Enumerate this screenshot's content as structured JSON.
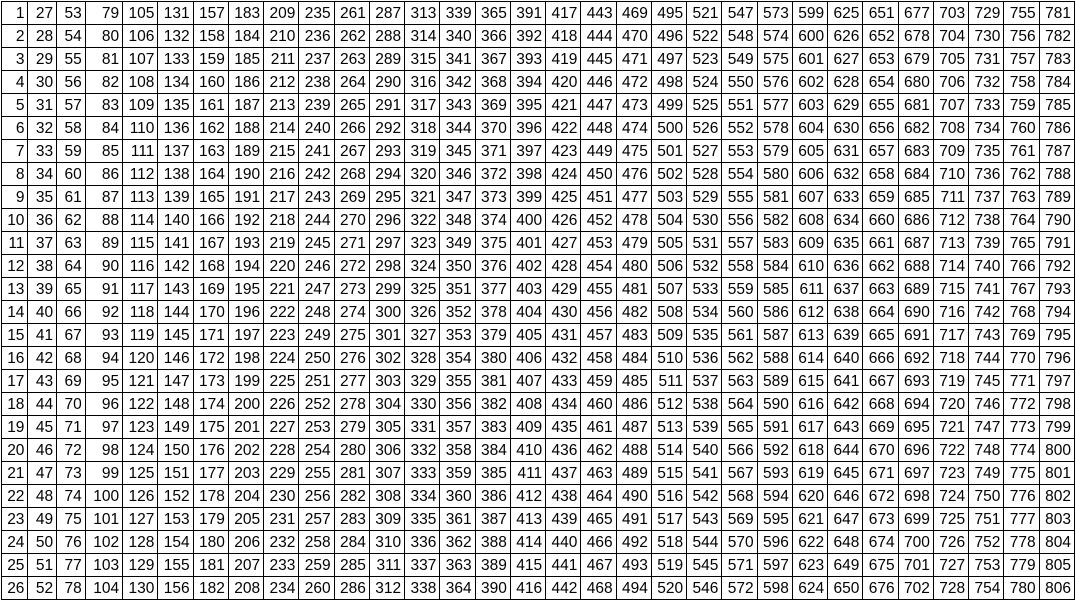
{
  "sheet": {
    "columns": 31,
    "rows": [
      [
        "1",
        "27",
        "53",
        "79",
        "105",
        "131",
        "157",
        "183",
        "209",
        "235",
        "261",
        "287",
        "313",
        "339",
        "365",
        "391",
        "417",
        "443",
        "469",
        "495",
        "521",
        "547",
        "573",
        "599",
        "625",
        "651",
        "677",
        "703",
        "729",
        "755",
        "781"
      ],
      [
        "2",
        "28",
        "54",
        "80",
        "106",
        "132",
        "158",
        "184",
        "210",
        "236",
        "262",
        "288",
        "314",
        "340",
        "366",
        "392",
        "418",
        "444",
        "470",
        "496",
        "522",
        "548",
        "574",
        "600",
        "626",
        "652",
        "678",
        "704",
        "730",
        "756",
        "782"
      ],
      [
        "3",
        "29",
        "55",
        "81",
        "107",
        "133",
        "159",
        "185",
        "211",
        "237",
        "263",
        "289",
        "315",
        "341",
        "367",
        "393",
        "419",
        "445",
        "471",
        "497",
        "523",
        "549",
        "575",
        "601",
        "627",
        "653",
        "679",
        "705",
        "731",
        "757",
        "783"
      ],
      [
        "4",
        "30",
        "56",
        "82",
        "108",
        "134",
        "160",
        "186",
        "212",
        "238",
        "264",
        "290",
        "316",
        "342",
        "368",
        "394",
        "420",
        "446",
        "472",
        "498",
        "524",
        "550",
        "576",
        "602",
        "628",
        "654",
        "680",
        "706",
        "732",
        "758",
        "784"
      ],
      [
        "5",
        "31",
        "57",
        "83",
        "109",
        "135",
        "161",
        "187",
        "213",
        "239",
        "265",
        "291",
        "317",
        "343",
        "369",
        "395",
        "421",
        "447",
        "473",
        "499",
        "525",
        "551",
        "577",
        "603",
        "629",
        "655",
        "681",
        "707",
        "733",
        "759",
        "785"
      ],
      [
        "6",
        "32",
        "58",
        "84",
        "110",
        "136",
        "162",
        "188",
        "214",
        "240",
        "266",
        "292",
        "318",
        "344",
        "370",
        "396",
        "422",
        "448",
        "474",
        "500",
        "526",
        "552",
        "578",
        "604",
        "630",
        "656",
        "682",
        "708",
        "734",
        "760",
        "786"
      ],
      [
        "7",
        "33",
        "59",
        "85",
        "111",
        "137",
        "163",
        "189",
        "215",
        "241",
        "267",
        "293",
        "319",
        "345",
        "371",
        "397",
        "423",
        "449",
        "475",
        "501",
        "527",
        "553",
        "579",
        "605",
        "631",
        "657",
        "683",
        "709",
        "735",
        "761",
        "787"
      ],
      [
        "8",
        "34",
        "60",
        "86",
        "112",
        "138",
        "164",
        "190",
        "216",
        "242",
        "268",
        "294",
        "320",
        "346",
        "372",
        "398",
        "424",
        "450",
        "476",
        "502",
        "528",
        "554",
        "580",
        "606",
        "632",
        "658",
        "684",
        "710",
        "736",
        "762",
        "788"
      ],
      [
        "9",
        "35",
        "61",
        "87",
        "113",
        "139",
        "165",
        "191",
        "217",
        "243",
        "269",
        "295",
        "321",
        "347",
        "373",
        "399",
        "425",
        "451",
        "477",
        "503",
        "529",
        "555",
        "581",
        "607",
        "633",
        "659",
        "685",
        "711",
        "737",
        "763",
        "789"
      ],
      [
        "10",
        "36",
        "62",
        "88",
        "114",
        "140",
        "166",
        "192",
        "218",
        "244",
        "270",
        "296",
        "322",
        "348",
        "374",
        "400",
        "426",
        "452",
        "478",
        "504",
        "530",
        "556",
        "582",
        "608",
        "634",
        "660",
        "686",
        "712",
        "738",
        "764",
        "790"
      ],
      [
        "11",
        "37",
        "63",
        "89",
        "115",
        "141",
        "167",
        "193",
        "219",
        "245",
        "271",
        "297",
        "323",
        "349",
        "375",
        "401",
        "427",
        "453",
        "479",
        "505",
        "531",
        "557",
        "583",
        "609",
        "635",
        "661",
        "687",
        "713",
        "739",
        "765",
        "791"
      ],
      [
        "12",
        "38",
        "64",
        "90",
        "116",
        "142",
        "168",
        "194",
        "220",
        "246",
        "272",
        "298",
        "324",
        "350",
        "376",
        "402",
        "428",
        "454",
        "480",
        "506",
        "532",
        "558",
        "584",
        "610",
        "636",
        "662",
        "688",
        "714",
        "740",
        "766",
        "792"
      ],
      [
        "13",
        "39",
        "65",
        "91",
        "117",
        "143",
        "169",
        "195",
        "221",
        "247",
        "273",
        "299",
        "325",
        "351",
        "377",
        "403",
        "429",
        "455",
        "481",
        "507",
        "533",
        "559",
        "585",
        "611",
        "637",
        "663",
        "689",
        "715",
        "741",
        "767",
        "793"
      ],
      [
        "14",
        "40",
        "66",
        "92",
        "118",
        "144",
        "170",
        "196",
        "222",
        "248",
        "274",
        "300",
        "326",
        "352",
        "378",
        "404",
        "430",
        "456",
        "482",
        "508",
        "534",
        "560",
        "586",
        "612",
        "638",
        "664",
        "690",
        "716",
        "742",
        "768",
        "794"
      ],
      [
        "15",
        "41",
        "67",
        "93",
        "119",
        "145",
        "171",
        "197",
        "223",
        "249",
        "275",
        "301",
        "327",
        "353",
        "379",
        "405",
        "431",
        "457",
        "483",
        "509",
        "535",
        "561",
        "587",
        "613",
        "639",
        "665",
        "691",
        "717",
        "743",
        "769",
        "795"
      ],
      [
        "16",
        "42",
        "68",
        "94",
        "120",
        "146",
        "172",
        "198",
        "224",
        "250",
        "276",
        "302",
        "328",
        "354",
        "380",
        "406",
        "432",
        "458",
        "484",
        "510",
        "536",
        "562",
        "588",
        "614",
        "640",
        "666",
        "692",
        "718",
        "744",
        "770",
        "796"
      ],
      [
        "17",
        "43",
        "69",
        "95",
        "121",
        "147",
        "173",
        "199",
        "225",
        "251",
        "277",
        "303",
        "329",
        "355",
        "381",
        "407",
        "433",
        "459",
        "485",
        "511",
        "537",
        "563",
        "589",
        "615",
        "641",
        "667",
        "693",
        "719",
        "745",
        "771",
        "797"
      ],
      [
        "18",
        "44",
        "70",
        "96",
        "122",
        "148",
        "174",
        "200",
        "226",
        "252",
        "278",
        "304",
        "330",
        "356",
        "382",
        "408",
        "434",
        "460",
        "486",
        "512",
        "538",
        "564",
        "590",
        "616",
        "642",
        "668",
        "694",
        "720",
        "746",
        "772",
        "798"
      ],
      [
        "19",
        "45",
        "71",
        "97",
        "123",
        "149",
        "175",
        "201",
        "227",
        "253",
        "279",
        "305",
        "331",
        "357",
        "383",
        "409",
        "435",
        "461",
        "487",
        "513",
        "539",
        "565",
        "591",
        "617",
        "643",
        "669",
        "695",
        "721",
        "747",
        "773",
        "799"
      ],
      [
        "20",
        "46",
        "72",
        "98",
        "124",
        "150",
        "176",
        "202",
        "228",
        "254",
        "280",
        "306",
        "332",
        "358",
        "384",
        "410",
        "436",
        "462",
        "488",
        "514",
        "540",
        "566",
        "592",
        "618",
        "644",
        "670",
        "696",
        "722",
        "748",
        "774",
        "800"
      ],
      [
        "21",
        "47",
        "73",
        "99",
        "125",
        "151",
        "177",
        "203",
        "229",
        "255",
        "281",
        "307",
        "333",
        "359",
        "385",
        "411",
        "437",
        "463",
        "489",
        "515",
        "541",
        "567",
        "593",
        "619",
        "645",
        "671",
        "697",
        "723",
        "749",
        "775",
        "801"
      ],
      [
        "22",
        "48",
        "74",
        "100",
        "126",
        "152",
        "178",
        "204",
        "230",
        "256",
        "282",
        "308",
        "334",
        "360",
        "386",
        "412",
        "438",
        "464",
        "490",
        "516",
        "542",
        "568",
        "594",
        "620",
        "646",
        "672",
        "698",
        "724",
        "750",
        "776",
        "802"
      ],
      [
        "23",
        "49",
        "75",
        "101",
        "127",
        "153",
        "179",
        "205",
        "231",
        "257",
        "283",
        "309",
        "335",
        "361",
        "387",
        "413",
        "439",
        "465",
        "491",
        "517",
        "543",
        "569",
        "595",
        "621",
        "647",
        "673",
        "699",
        "725",
        "751",
        "777",
        "803"
      ],
      [
        "24",
        "50",
        "76",
        "102",
        "128",
        "154",
        "180",
        "206",
        "232",
        "258",
        "284",
        "310",
        "336",
        "362",
        "388",
        "414",
        "440",
        "466",
        "492",
        "518",
        "544",
        "570",
        "596",
        "622",
        "648",
        "674",
        "700",
        "726",
        "752",
        "778",
        "804"
      ],
      [
        "25",
        "51",
        "77",
        "103",
        "129",
        "155",
        "181",
        "207",
        "233",
        "259",
        "285",
        "311",
        "337",
        "363",
        "389",
        "415",
        "441",
        "467",
        "493",
        "519",
        "545",
        "571",
        "597",
        "623",
        "649",
        "675",
        "701",
        "727",
        "753",
        "779",
        "805"
      ],
      [
        "26",
        "52",
        "78",
        "104",
        "130",
        "156",
        "182",
        "208",
        "234",
        "260",
        "286",
        "312",
        "338",
        "364",
        "390",
        "416",
        "442",
        "468",
        "494",
        "520",
        "546",
        "572",
        "598",
        "624",
        "650",
        "676",
        "702",
        "728",
        "754",
        "780",
        "806"
      ]
    ]
  }
}
